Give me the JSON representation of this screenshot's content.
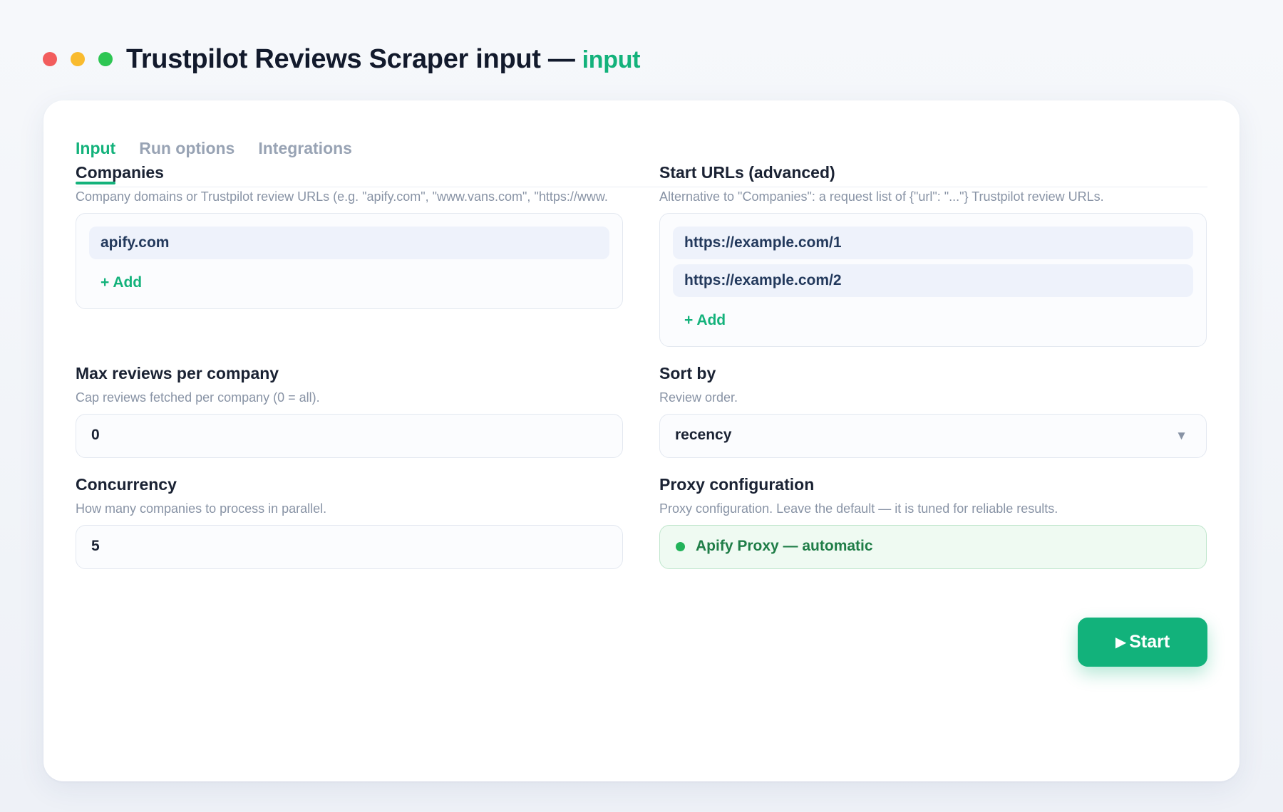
{
  "window": {
    "title": "Trustpilot Reviews Scraper input —",
    "mode": "input"
  },
  "tabs": [
    {
      "label": "Input",
      "active": true
    },
    {
      "label": "Run options",
      "active": false
    },
    {
      "label": "Integrations",
      "active": false
    }
  ],
  "companies": {
    "label": "Companies",
    "description": "Company domains or Trustpilot review URLs (e.g. \"apify.com\", \"www.vans.com\", \"https://www.",
    "items": [
      "apify.com"
    ],
    "add_label": "+ Add"
  },
  "start_urls": {
    "label": "Start URLs (advanced)",
    "description": "Alternative to \"Companies\": a request list of {\"url\": \"...\"} Trustpilot review URLs.",
    "items": [
      "https://example.com/1",
      "https://example.com/2"
    ],
    "add_label": "+ Add"
  },
  "max_reviews": {
    "label": "Max reviews per company",
    "description": "Cap reviews fetched per company (0 = all).",
    "value": "0"
  },
  "sort_by": {
    "label": "Sort by",
    "description": "Review order.",
    "value": "recency",
    "arrow": "▼"
  },
  "concurrency": {
    "label": "Concurrency",
    "description": "How many companies to process in parallel.",
    "value": "5"
  },
  "proxy": {
    "label": "Proxy configuration",
    "description": "Proxy configuration. Leave the default — it is tuned for reliable results.",
    "value": "Apify Proxy — automatic"
  },
  "start_button": {
    "icon": "▶",
    "label": "Start"
  },
  "colors": {
    "accent": "#13b27b",
    "proxy_ok": "#22b35a"
  }
}
